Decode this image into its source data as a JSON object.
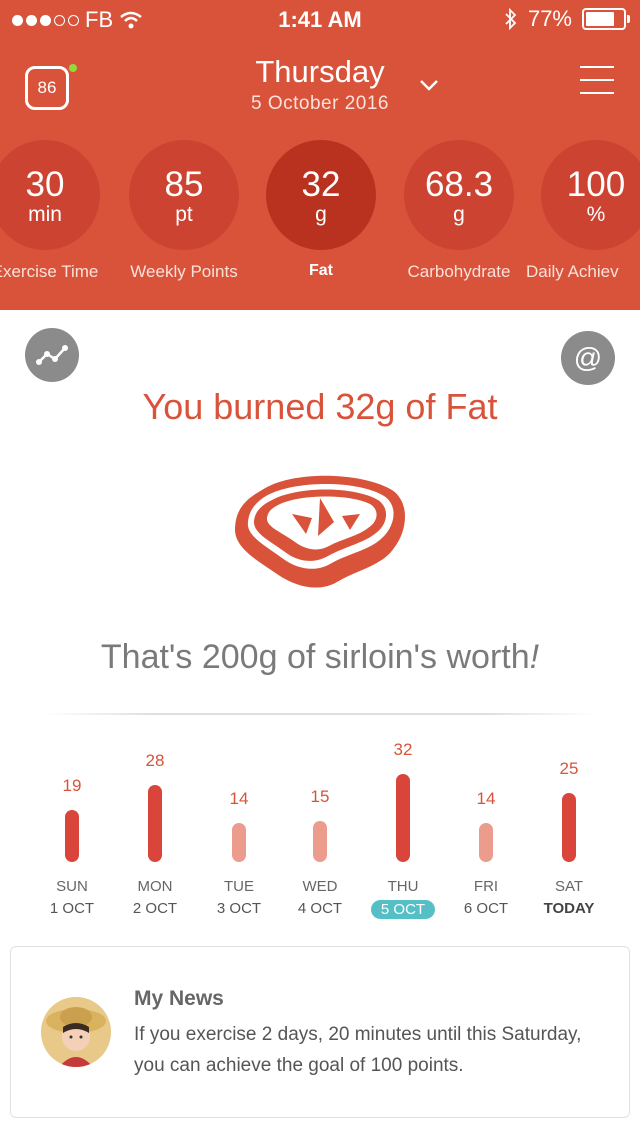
{
  "status_bar": {
    "carrier": "FB",
    "time": "1:41 AM",
    "battery": "77%",
    "battery_level": 0.77
  },
  "nav": {
    "score": "86",
    "day": "Thursday",
    "date": "5 October 2016"
  },
  "stats": [
    {
      "value": "30",
      "unit": "min",
      "label": "Exercise Time"
    },
    {
      "value": "85",
      "unit": "pt",
      "label": "Weekly Points"
    },
    {
      "value": "32",
      "unit": "g",
      "label": "Fat"
    },
    {
      "value": "68.3",
      "unit": "g",
      "label": "Carbohydrate"
    },
    {
      "value": "100",
      "unit": "%",
      "label": "Daily Achiev"
    }
  ],
  "content": {
    "headline": "You burned 32g of Fat",
    "worth_main": "That's 200g of sirloin's worth",
    "worth_suffix": "!",
    "at_symbol": "@"
  },
  "week": {
    "days": [
      {
        "name": "SUN",
        "date": "1 OCT",
        "value": 19
      },
      {
        "name": "MON",
        "date": "2 OCT",
        "value": 28
      },
      {
        "name": "TUE",
        "date": "3 OCT",
        "value": 14
      },
      {
        "name": "WED",
        "date": "4 OCT",
        "value": 15
      },
      {
        "name": "THU",
        "date": "5 OCT",
        "value": 32
      },
      {
        "name": "FRI",
        "date": "6 OCT",
        "value": 14
      },
      {
        "name": "SAT",
        "date": "TODAY",
        "value": 25
      }
    ]
  },
  "news": {
    "title": "My News",
    "body": "If you exercise 2 days, 20 minutes until this Saturday, you can achieve the goal of 100 points."
  },
  "colors": {
    "brand": "#d9533a",
    "selected": "#55bfc6"
  }
}
